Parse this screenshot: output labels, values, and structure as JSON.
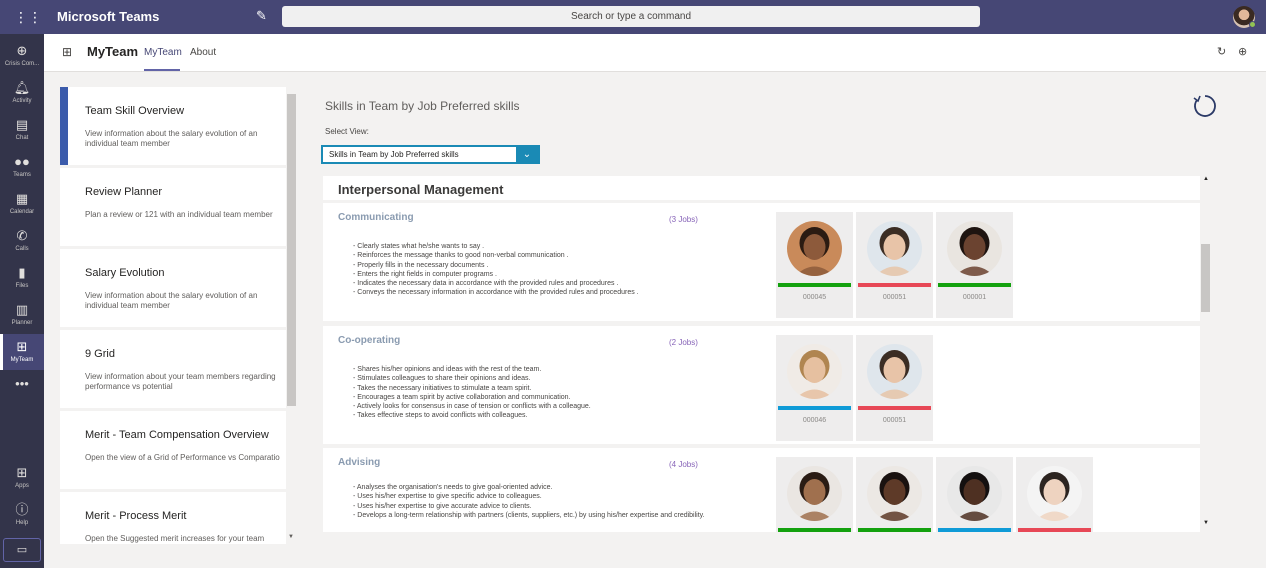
{
  "titlebar": {
    "app_name": "Microsoft Teams",
    "search_placeholder": "Search or type a command"
  },
  "rail": {
    "items": [
      {
        "label": "Crisis Com...",
        "icon": "globe-icon"
      },
      {
        "label": "Activity",
        "icon": "bell-icon"
      },
      {
        "label": "Chat",
        "icon": "chat-icon"
      },
      {
        "label": "Teams",
        "icon": "teams-icon"
      },
      {
        "label": "Calendar",
        "icon": "calendar-icon"
      },
      {
        "label": "Calls",
        "icon": "phone-icon"
      },
      {
        "label": "Files",
        "icon": "file-icon"
      },
      {
        "label": "Planner",
        "icon": "planner-icon"
      },
      {
        "label": "MyTeam",
        "icon": "myteam-icon"
      },
      {
        "label": "",
        "icon": "more-icon"
      }
    ],
    "bottom": [
      {
        "label": "Apps",
        "icon": "apps-icon"
      },
      {
        "label": "Help",
        "icon": "help-icon"
      }
    ]
  },
  "header": {
    "title": "MyTeam",
    "tabs": [
      {
        "label": "MyTeam",
        "active": true
      },
      {
        "label": "About",
        "active": false
      }
    ]
  },
  "left_cards": [
    {
      "title": "Team Skill Overview",
      "desc": "View information about the salary evolution of an individual team member",
      "selected": true
    },
    {
      "title": "Review Planner",
      "desc": "Plan a review or 121 with an individual team member",
      "selected": false
    },
    {
      "title": "Salary Evolution",
      "desc": "View information about the salary evolution of an individual team member",
      "selected": false
    },
    {
      "title": "9 Grid",
      "desc": "View information about your team members regarding performance vs potential",
      "selected": false
    },
    {
      "title": "Merit - Team Compensation Overview",
      "desc": "Open the view of a Grid of Performance vs Comparatio",
      "selected": false
    },
    {
      "title": "Merit - Process Merit",
      "desc": "Open the Suggested merit increases for your team",
      "selected": false
    }
  ],
  "main": {
    "title": "Skills in Team by Job Preferred skills",
    "select_label": "Select View:",
    "select_value": "Skills in Team by Job Preferred skills",
    "group": "Interpersonal Management",
    "skills": [
      {
        "name": "Communicating",
        "jobs": "(3 Jobs)",
        "lines": [
          "- Clearly states what he/she wants to say .",
          "- Reinforces the message thanks to good non-verbal communication .",
          "- Properly fills in the necessary documents .",
          "- Enters the right fields in computer programs .",
          "- Indicates the necessary data in accordance with the provided rules and procedures .",
          "- Conveys the necessary information in accordance with the provided rules and procedures ."
        ],
        "employees": [
          {
            "id": "000045",
            "color": "#13a10e",
            "skin": "#8d5a3b",
            "hair": "#2b1b12",
            "bg": "#c98a5a"
          },
          {
            "id": "000051",
            "color": "#e74856",
            "skin": "#e8c4a8",
            "hair": "#3b2d24",
            "bg": "#dfe6ec"
          },
          {
            "id": "000001",
            "color": "#13a10e",
            "skin": "#6b4330",
            "hair": "#1e1410",
            "bg": "#e9e5e0"
          }
        ]
      },
      {
        "name": "Co-operating",
        "jobs": "(2 Jobs)",
        "lines": [
          "- Shares his/her opinions and ideas with the rest of the team.",
          "- Stimulates colleagues to share their opinions and ideas.",
          "- Takes the necessary initiatives to stimulate a team spirit.",
          "- Encourages a team spirit by active collaboration and communication.",
          "- Actively looks for consensus in case of tension or conflicts with a colleague.",
          "- Takes effective steps to avoid conflicts with colleagues."
        ],
        "employees": [
          {
            "id": "000046",
            "color": "#0f9bd7",
            "skin": "#e6c0a0",
            "hair": "#b08550",
            "bg": "#f0ebe6"
          },
          {
            "id": "000051",
            "color": "#e74856",
            "skin": "#e8c4a8",
            "hair": "#3b2d24",
            "bg": "#dfe6ec"
          }
        ]
      },
      {
        "name": "Advising",
        "jobs": "(4 Jobs)",
        "lines": [
          "- Analyses the organisation's needs to give goal-oriented advice.",
          "- Uses his/her expertise to give specific advice to colleagues.",
          "- Uses his/her expertise to give accurate advice to clients.",
          "- Develops a long-term relationship with partners (clients, suppliers, etc.) by using his/her expertise and credibility."
        ],
        "employees": [
          {
            "id": "",
            "color": "#13a10e",
            "skin": "#a0704e",
            "hair": "#2a1c14",
            "bg": "#eae6e2"
          },
          {
            "id": "",
            "color": "#13a10e",
            "skin": "#5e3a28",
            "hair": "#1a1210",
            "bg": "#ece8e4"
          },
          {
            "id": "",
            "color": "#0f9bd7",
            "skin": "#4e3022",
            "hair": "#141010",
            "bg": "#e8e8e8"
          },
          {
            "id": "",
            "color": "#e74856",
            "skin": "#eed3c0",
            "hair": "#2c2420",
            "bg": "#f4f4f4"
          }
        ]
      }
    ]
  }
}
